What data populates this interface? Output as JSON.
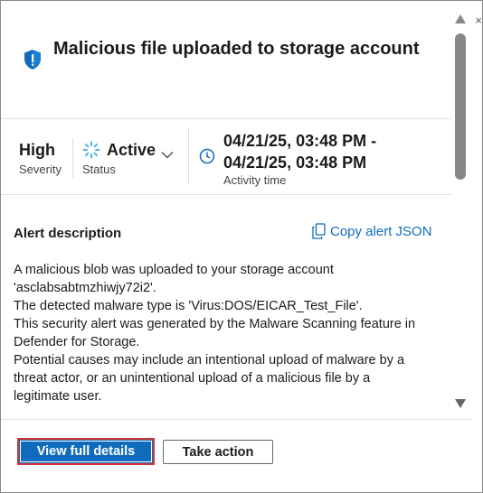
{
  "panel": {
    "close_glyph": "×",
    "title": "Malicious file uploaded to storage account"
  },
  "summary": {
    "severity": {
      "value": "High",
      "label": "Severity"
    },
    "status": {
      "value": "Active",
      "label": "Status"
    },
    "activity_time": {
      "value": "04/21/25, 03:48 PM - 04/21/25, 03:48 PM",
      "label": "Activity time"
    }
  },
  "description": {
    "heading": "Alert description",
    "copy_link_label": "Copy alert JSON",
    "lines": [
      "A malicious blob was uploaded to your storage account 'asclabsabtmzhiwjy72i2'.",
      "The detected malware type is 'Virus:DOS/EICAR_Test_File'.",
      "This security alert was generated by the Malware Scanning feature in Defender for Storage.",
      "Potential causes may include an intentional upload of malware by a threat actor, or an unintentional upload of a malicious file by a legitimate user."
    ]
  },
  "footer": {
    "primary_label": "View full details",
    "secondary_label": "Take action"
  },
  "colors": {
    "accent": "#0f6cbd",
    "highlight_border": "#d13438",
    "shield": "#0f6cbd",
    "spinner": "#4fb3e8"
  },
  "icons": [
    "shield-alert-icon",
    "spinner-icon",
    "chevron-down-icon",
    "clock-icon",
    "copy-icon",
    "close-icon",
    "scroll-up-arrow",
    "scroll-down-arrow"
  ]
}
